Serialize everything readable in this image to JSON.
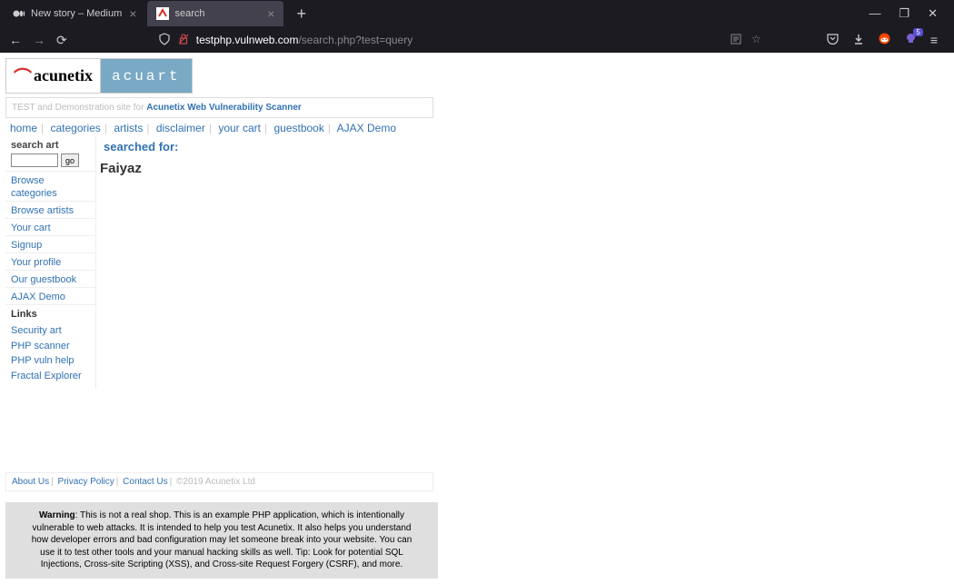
{
  "tabs": [
    {
      "title": "New story – Medium",
      "active": false
    },
    {
      "title": "search",
      "active": true
    }
  ],
  "url": {
    "domain": "testphp.vulnweb.com",
    "path": "/search.php?test=query"
  },
  "extension_badge": "5",
  "logo": {
    "left": "acunetix",
    "right": "acuart"
  },
  "test_banner": {
    "prefix": "TEST and Demonstration site for ",
    "link": "Acunetix Web Vulnerability Scanner"
  },
  "nav_menu": [
    "home",
    "categories",
    "artists",
    "disclaimer",
    "your cart",
    "guestbook",
    "AJAX Demo"
  ],
  "sidebar": {
    "search_title": "search art",
    "go_label": "go",
    "items": [
      "Browse categories",
      "Browse artists",
      "Your cart",
      "Signup",
      "Your profile",
      "Our guestbook",
      "AJAX Demo"
    ],
    "links_title": "Links",
    "links": [
      "Security art",
      "PHP scanner",
      "PHP vuln help",
      "Fractal Explorer"
    ]
  },
  "main": {
    "searched_label": "searched for:",
    "result": "Faiyaz"
  },
  "footer": {
    "links": [
      "About Us",
      "Privacy Policy",
      "Contact Us"
    ],
    "copyright": "©2019 Acunetix Ltd"
  },
  "warning": {
    "label": "Warning",
    "text": ": This is not a real shop. This is an example PHP application, which is intentionally vulnerable to web attacks. It is intended to help you test Acunetix. It also helps you understand how developer errors and bad configuration may let someone break into your website. You can use it to test other tools and your manual hacking skills as well. Tip: Look for potential SQL Injections, Cross-site Scripting (XSS), and Cross-site Request Forgery (CSRF), and more."
  }
}
